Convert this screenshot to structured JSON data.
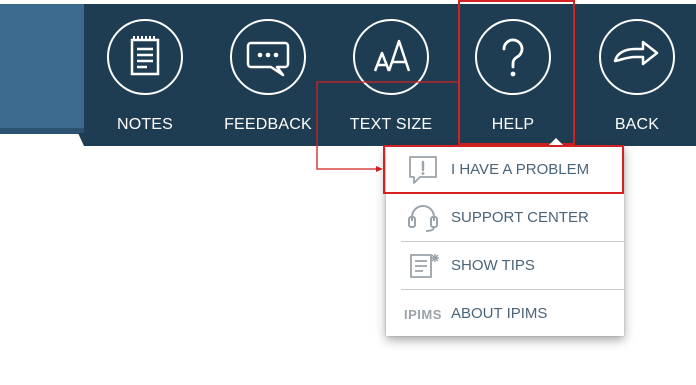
{
  "toolbar": {
    "items": [
      {
        "label": "NOTES",
        "icon": "notes-icon"
      },
      {
        "label": "FEEDBACK",
        "icon": "feedback-icon"
      },
      {
        "label": "TEXT SIZE",
        "icon": "text-size-icon"
      },
      {
        "label": "HELP",
        "icon": "help-icon"
      },
      {
        "label": "BACK",
        "icon": "back-icon"
      }
    ]
  },
  "help_menu": {
    "items": [
      {
        "label": "I HAVE A PROBLEM",
        "icon": "problem-icon"
      },
      {
        "label": "SUPPORT CENTER",
        "icon": "headset-icon"
      },
      {
        "label": "SHOW TIPS",
        "icon": "tips-icon"
      },
      {
        "label": "ABOUT IPIMS",
        "icon": "ipims-logo"
      }
    ],
    "logo_text": "IPIMS"
  },
  "colors": {
    "toolbar_bg": "#1f3d52",
    "side_block": "#3d6a8f",
    "highlight": "#d42121",
    "menu_text": "#4a6478"
  }
}
